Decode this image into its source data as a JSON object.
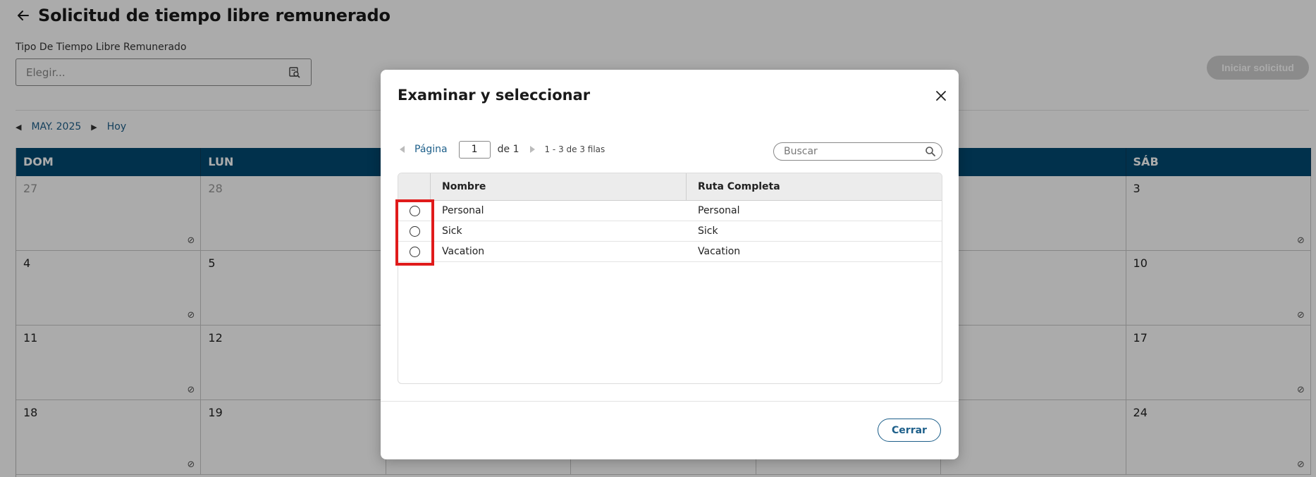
{
  "page": {
    "title": "Solicitud de tiempo libre remunerado",
    "field_label": "Tipo De Tiempo Libre Remunerado",
    "select_placeholder": "Elegir...",
    "start_button": "Iniciar solicitud",
    "calendar": {
      "month_label": "MAY. 2025",
      "today_label": "Hoy",
      "weekdays": [
        "DOM",
        "LUN",
        "",
        "",
        "",
        "E",
        "SÁB"
      ],
      "weeks": [
        [
          "27",
          "28",
          "",
          "",
          "",
          "",
          "3"
        ],
        [
          "4",
          "5",
          "",
          "",
          "",
          "",
          "10"
        ],
        [
          "11",
          "12",
          "",
          "",
          "",
          "6",
          "17"
        ],
        [
          "18",
          "19",
          "",
          "",
          "",
          "3",
          "24"
        ]
      ]
    }
  },
  "modal": {
    "title": "Examinar y seleccionar",
    "pager": {
      "page_label": "Página",
      "page_value": "1",
      "of_label": "de 1",
      "rows_label": "1 - 3 de 3 filas"
    },
    "search_placeholder": "Buscar",
    "columns": {
      "name": "Nombre",
      "full_path": "Ruta Completa"
    },
    "rows": [
      {
        "name": "Personal",
        "full_path": "Personal"
      },
      {
        "name": "Sick",
        "full_path": "Sick"
      },
      {
        "name": "Vacation",
        "full_path": "Vacation"
      }
    ],
    "close_button": "Cerrar"
  },
  "colors": {
    "accent": "#1d5f8a",
    "calendar_header": "#024a72",
    "highlight": "#e01b1b"
  }
}
